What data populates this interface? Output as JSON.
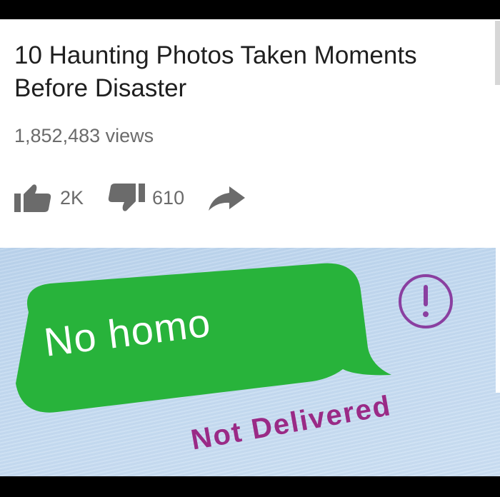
{
  "video": {
    "title": "10 Haunting Photos Taken Moments Before Disaster",
    "views": "1,852,483 views",
    "actions": {
      "like": {
        "icon": "thumbs-up-icon",
        "count": "2K"
      },
      "dislike": {
        "icon": "thumbs-down-icon",
        "count": "610"
      },
      "share": {
        "icon": "share-arrow-icon"
      }
    },
    "colors": {
      "text": "#1f1f1f",
      "meta": "#6b6b6b"
    }
  },
  "message": {
    "text": "No homo",
    "status": "Not Delivered",
    "icon": "exclamation-circle-icon",
    "colors": {
      "bubble": "#28b33b",
      "bubble_text": "#ffffff",
      "status": "#9a2a86",
      "background": "#c4daf0"
    }
  }
}
